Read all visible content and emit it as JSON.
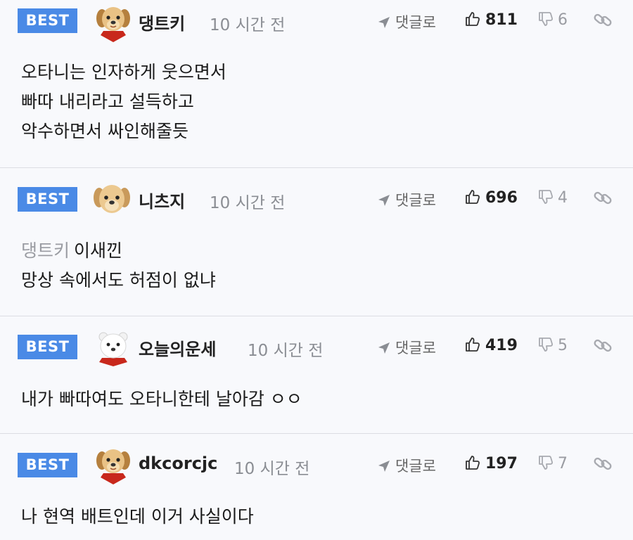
{
  "comments": [
    {
      "badge": "BEST",
      "avatar_icon": "puppy-red-cape-icon",
      "nickname": "댕트키",
      "time": "10 시간 전",
      "reply_label": "댓글로",
      "likes": "811",
      "dislikes": "6",
      "lines": [
        "오타니는 인자하게 웃으면서",
        "빠따 내리라고 설득하고",
        "악수하면서 싸인해줄듯"
      ]
    },
    {
      "badge": "BEST",
      "avatar_icon": "puppy-face-icon",
      "nickname": "니츠지",
      "time": "10 시간 전",
      "reply_label": "댓글로",
      "likes": "696",
      "dislikes": "4",
      "mention": "댕트키",
      "lines": [
        "이새낀",
        "망상 속에서도 허점이 없냐"
      ]
    },
    {
      "badge": "BEST",
      "avatar_icon": "polar-bear-icon",
      "nickname": "오늘의운세",
      "time": "10 시간 전",
      "reply_label": "댓글로",
      "likes": "419",
      "dislikes": "5",
      "lines": [
        "내가 빠따여도 오타니한테 날아감 ㅇㅇ"
      ]
    },
    {
      "badge": "BEST",
      "avatar_icon": "puppy-red-cape-icon",
      "nickname": "dkcorcjc",
      "time": "10 시간 전",
      "reply_label": "댓글로",
      "likes": "197",
      "dislikes": "7",
      "lines": [
        "나 현역 배트인데 이거 사실이다"
      ]
    }
  ],
  "colors": {
    "badge": "#4a8ae6",
    "background": "#f8f9fc",
    "muted": "#8a8d93"
  }
}
